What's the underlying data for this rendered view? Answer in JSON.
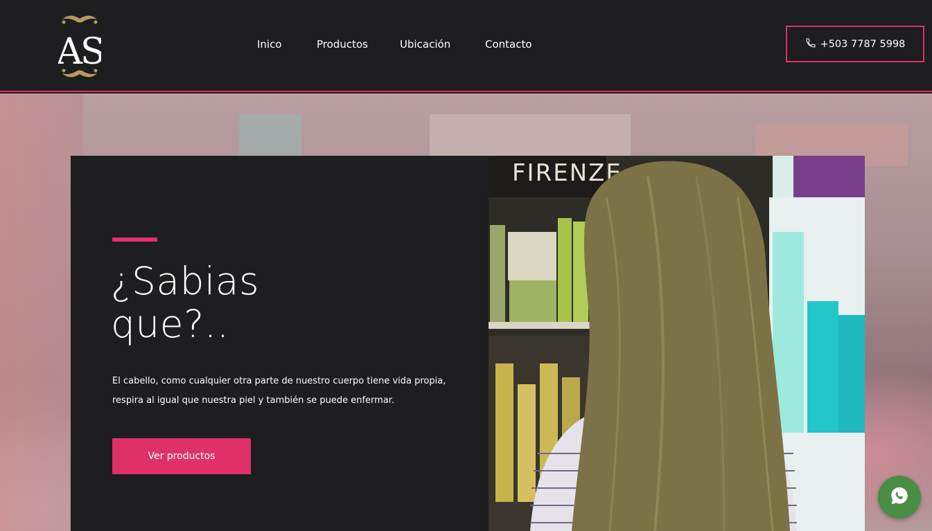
{
  "brand": {
    "logo_text": "AS"
  },
  "nav": {
    "items": [
      {
        "label": "Inico"
      },
      {
        "label": "Productos"
      },
      {
        "label": "Ubicación"
      },
      {
        "label": "Contacto"
      }
    ]
  },
  "header": {
    "phone_label": "+503 7787 5998"
  },
  "hero": {
    "headline_line1": "¿Sabias",
    "headline_line2": "que?..",
    "body": "El cabello, como cualquier otra parte de nuestro cuerpo tiene vida propia, respira al igual que nuestra piel y también se puede enfermar.",
    "cta_label": "Ver productos"
  },
  "photo": {
    "shop_sign": "FIRENZE"
  },
  "colors": {
    "accent": "#e0306a",
    "dark": "#1e1d1f",
    "whatsapp": "#4a8d45"
  },
  "icons": {
    "phone": "phone-icon",
    "whatsapp": "whatsapp-icon"
  }
}
